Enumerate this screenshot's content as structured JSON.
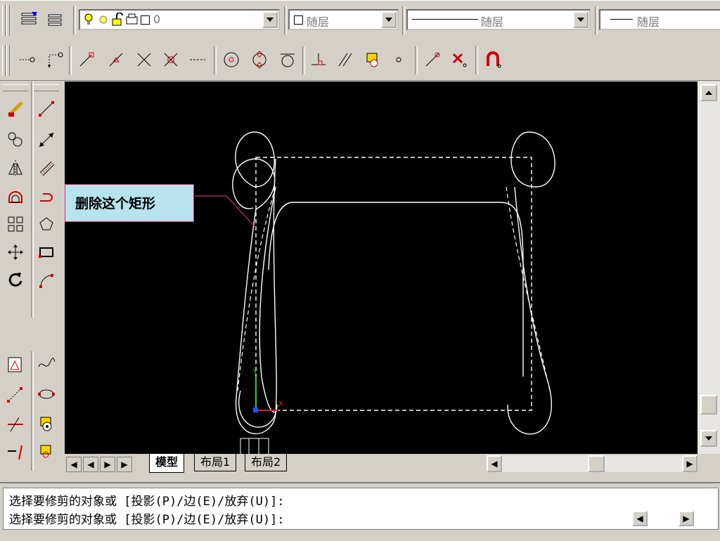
{
  "layers_toolbar": {
    "layer_name": "0",
    "color_value": "随层",
    "linetype_value": "随层",
    "lineweight_value": "随层"
  },
  "icons": {
    "layer_manager": "layer-manager-icon",
    "make_current": "make-object-layer-current-icon",
    "bulb": "layer-on-icon",
    "sun": "layer-thaw-icon",
    "lock": "layer-unlock-icon",
    "plot": "layer-plot-icon"
  },
  "drawing": {
    "callout_text": "删除这个矩形",
    "ucs_y": "Y",
    "ucs_x": "X"
  },
  "layout_tabs": [
    {
      "label": "模型"
    },
    {
      "label": "布局1"
    },
    {
      "label": "布局2"
    }
  ],
  "command": {
    "line1": "选择要修剪的对象或 [投影(P)/边(E)/放弃(U)]:",
    "line2": "选择要修剪的对象或 [投影(P)/边(E)/放弃(U)]:"
  },
  "colors": {
    "canvas": "#000000",
    "chrome": "#d4d0c8",
    "callout_bg": "#b7e3ee",
    "callout_border": "#d52e6e"
  }
}
